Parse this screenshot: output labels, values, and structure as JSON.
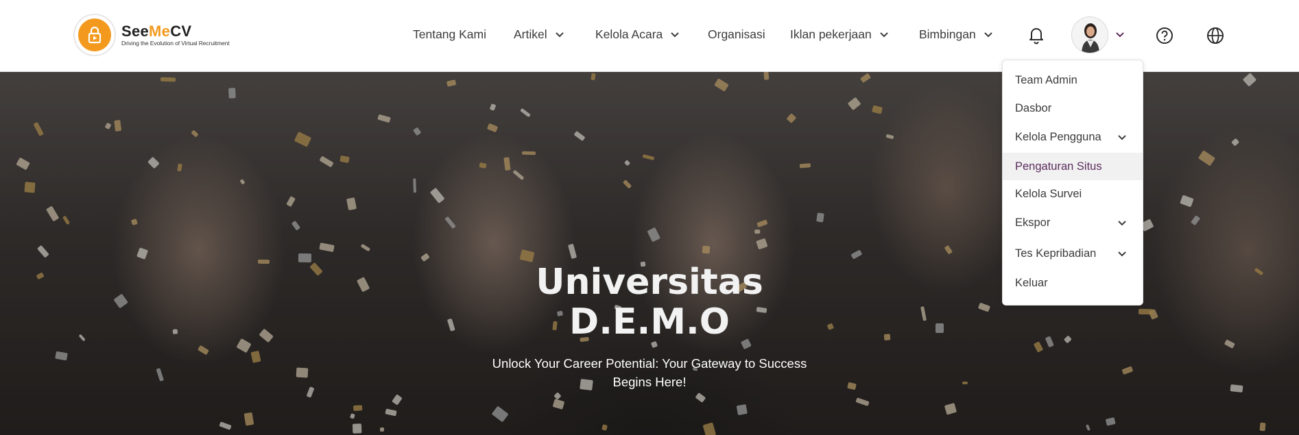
{
  "brand": {
    "name_prefix": "See",
    "name_accent": "Me",
    "name_suffix": "CV",
    "tagline": "Driving the Evolution of Virtual Recruitment",
    "accent_color": "#f39a1e"
  },
  "nav": {
    "items": [
      {
        "label": "Tentang Kami",
        "has_dropdown": false
      },
      {
        "label": "Artikel",
        "has_dropdown": true
      },
      {
        "label": "Kelola Acara",
        "has_dropdown": true
      },
      {
        "label": "Organisasi",
        "has_dropdown": false
      },
      {
        "label": "Iklan pekerjaan",
        "has_dropdown": true
      },
      {
        "label": "Bimbingan",
        "has_dropdown": true
      }
    ],
    "icons": [
      "bell-icon",
      "user-avatar",
      "chevron-down-icon",
      "help-icon",
      "globe-icon"
    ]
  },
  "user_menu": {
    "items": [
      {
        "label": "Team Admin",
        "has_submenu": false,
        "active": false
      },
      {
        "label": "Dasbor",
        "has_submenu": false,
        "active": false
      },
      {
        "label": "Kelola Pengguna",
        "has_submenu": true,
        "active": false
      },
      {
        "label": "Pengaturan Situs",
        "has_submenu": false,
        "active": true
      },
      {
        "label": "Kelola Survei",
        "has_submenu": false,
        "active": false
      },
      {
        "label": "Ekspor",
        "has_submenu": true,
        "active": false
      },
      {
        "label": "Tes Kepribadian",
        "has_submenu": true,
        "active": false
      },
      {
        "label": "Keluar",
        "has_submenu": false,
        "active": false
      }
    ],
    "active_color": "#5b2d5e"
  },
  "hero": {
    "title_line1": "Universitas",
    "title_line2": "D.E.M.O",
    "subtitle_line1": "Unlock Your Career Potential: Your Gateway to Success",
    "subtitle_line2": "Begins Here!"
  }
}
